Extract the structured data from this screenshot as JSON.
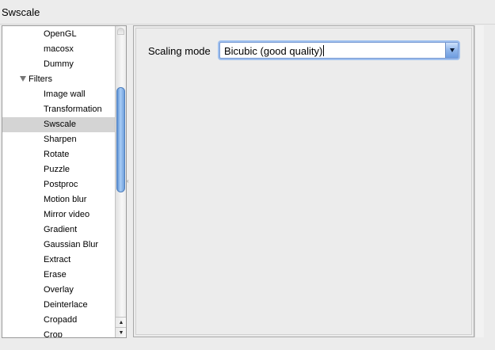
{
  "window": {
    "title": "Swscale"
  },
  "tree": {
    "items": [
      {
        "label": "OpenGL",
        "kind": "leaf",
        "selected": false
      },
      {
        "label": "macosx",
        "kind": "leaf",
        "selected": false
      },
      {
        "label": "Dummy",
        "kind": "leaf",
        "selected": false
      },
      {
        "label": "Filters",
        "kind": "group",
        "selected": false
      },
      {
        "label": "Image wall",
        "kind": "leaf",
        "selected": false
      },
      {
        "label": "Transformation",
        "kind": "leaf",
        "selected": false
      },
      {
        "label": "Swscale",
        "kind": "leaf",
        "selected": true
      },
      {
        "label": "Sharpen",
        "kind": "leaf",
        "selected": false
      },
      {
        "label": "Rotate",
        "kind": "leaf",
        "selected": false
      },
      {
        "label": "Puzzle",
        "kind": "leaf",
        "selected": false
      },
      {
        "label": "Postproc",
        "kind": "leaf",
        "selected": false
      },
      {
        "label": "Motion blur",
        "kind": "leaf",
        "selected": false
      },
      {
        "label": "Mirror video",
        "kind": "leaf",
        "selected": false
      },
      {
        "label": "Gradient",
        "kind": "leaf",
        "selected": false
      },
      {
        "label": "Gaussian Blur",
        "kind": "leaf",
        "selected": false
      },
      {
        "label": "Extract",
        "kind": "leaf",
        "selected": false
      },
      {
        "label": "Erase",
        "kind": "leaf",
        "selected": false
      },
      {
        "label": "Overlay",
        "kind": "leaf",
        "selected": false
      },
      {
        "label": "Deinterlace",
        "kind": "leaf",
        "selected": false
      },
      {
        "label": "Cropadd",
        "kind": "leaf",
        "selected": false
      },
      {
        "label": "Crop",
        "kind": "leaf",
        "selected": false
      }
    ]
  },
  "settings": {
    "scaling_mode_label": "Scaling mode",
    "scaling_mode_value": "Bicubic (good quality)"
  },
  "icons": {
    "scroll_up": "▲",
    "scroll_down": "▼",
    "splitter": "‹"
  },
  "colors": {
    "selection": "#d4d4d4",
    "accent": "#7a9bd3"
  }
}
